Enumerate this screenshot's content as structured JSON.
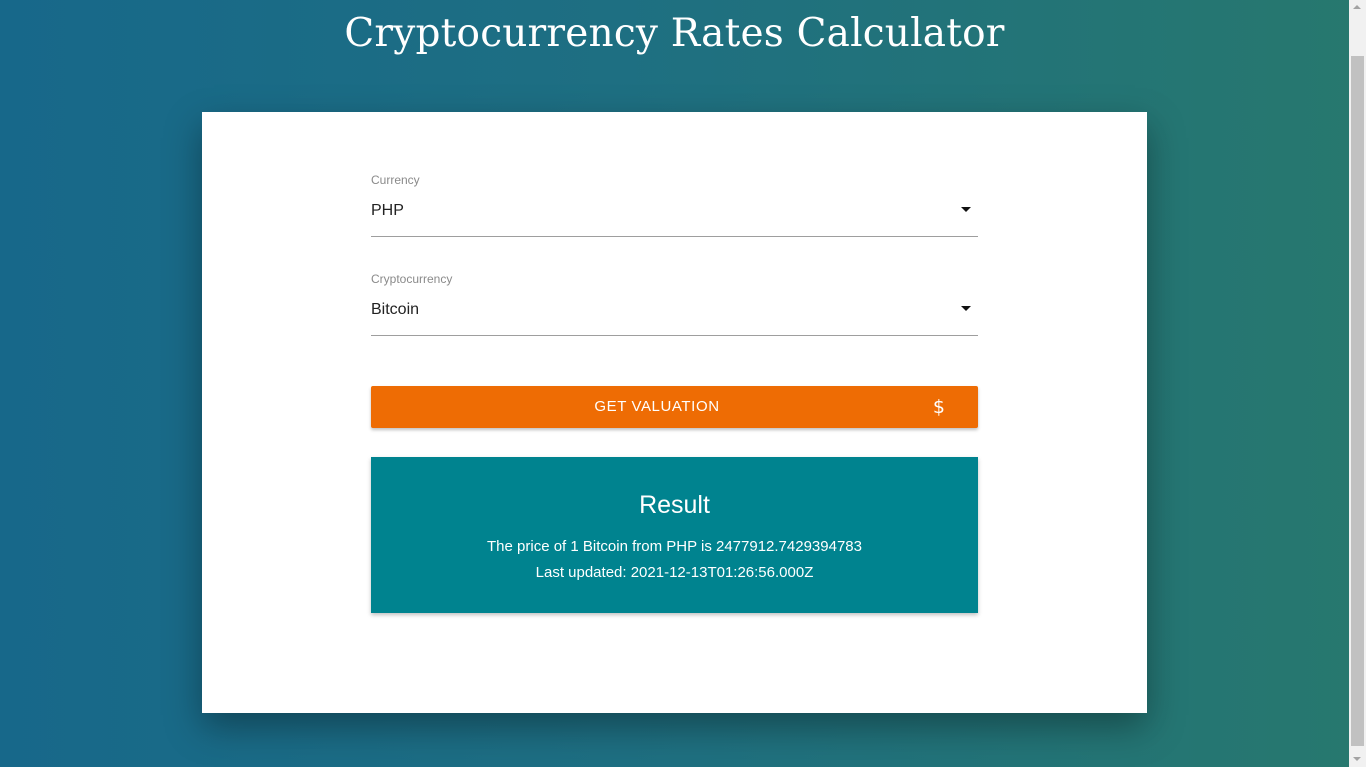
{
  "header": {
    "title": "Cryptocurrency Rates Calculator"
  },
  "form": {
    "currency": {
      "label": "Currency",
      "value": "PHP"
    },
    "cryptocurrency": {
      "label": "Cryptocurrency",
      "value": "Bitcoin"
    },
    "submit": {
      "label": "GET VALUATION",
      "icon": "$",
      "icon_name": "dollar-icon",
      "color": "#ee6c04"
    }
  },
  "result": {
    "title": "Result",
    "price_line": "The price of 1 Bitcoin from PHP is 2477912.7429394783",
    "updated_line": "Last updated: 2021-12-13T01:26:56.000Z",
    "color": "#00838f"
  },
  "theme": {
    "gradient_left": "#17688a",
    "gradient_right": "#27786e"
  }
}
